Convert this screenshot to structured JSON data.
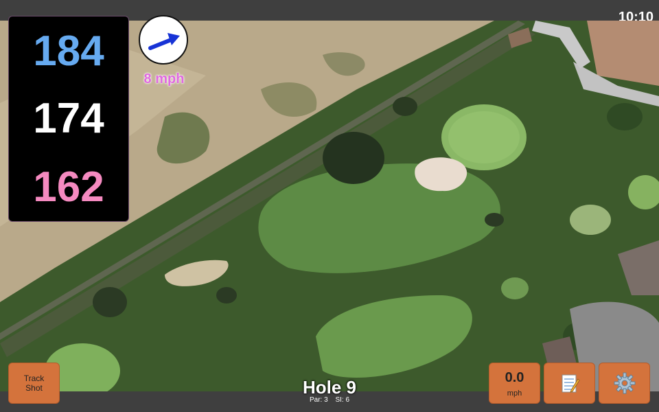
{
  "status": {
    "time": "10:10"
  },
  "yardages": {
    "back": "184",
    "middle": "174",
    "front": "162"
  },
  "wind": {
    "label": "8 mph",
    "icon": "arrow-up-right-icon"
  },
  "controls": {
    "track_shot": "Track\nShot",
    "speed_value": "0.0",
    "speed_unit": "mph",
    "notes_icon": "notepad-icon",
    "settings_icon": "gear-icon"
  },
  "hole": {
    "title": "Hole 9",
    "par": "Par: 3",
    "si": "SI: 6"
  },
  "colors": {
    "back": "#66aaf0",
    "middle": "#ffffff",
    "front": "#f58ac0",
    "button": "#d4733c",
    "wind_text": "#e06ae0"
  }
}
